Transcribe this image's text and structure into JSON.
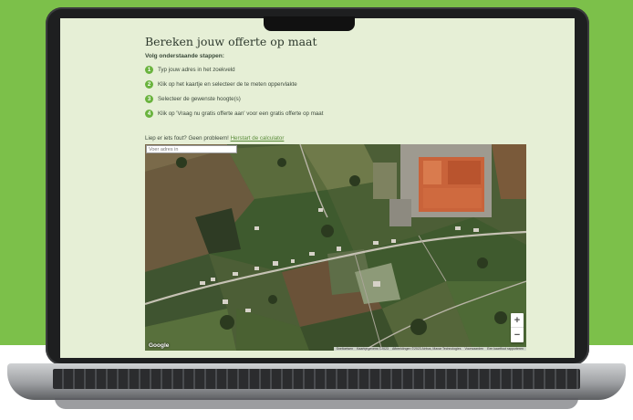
{
  "page": {
    "title": "Bereken jouw offerte op maat",
    "subtitle": "Volg onderstaande stappen:",
    "steps": [
      {
        "num": "1",
        "text": "Typ jouw adres in het zoekveld"
      },
      {
        "num": "2",
        "text": "Klik op het kaartje en selecteer de te meten oppervlakte"
      },
      {
        "num": "3",
        "text": "Selecteer de gewenste hoogte(s)"
      },
      {
        "num": "4",
        "text": "Klik op 'Vraag nu gratis offerte aan' voor een gratis offerte op maat"
      }
    ],
    "restart_prompt": "Liep er iets fout? Geen probleem!",
    "restart_link": "Herstart de calculator"
  },
  "map": {
    "search_placeholder": "Voer adres in",
    "zoom_in": "+",
    "zoom_out": "−",
    "logo": "Google",
    "attribution": [
      "Sneltoetsen",
      "Kaartgegevens ©2023",
      "Afbeeldingen ©2023 Airbus, Maxar Technologies",
      "Voorwaarden",
      "Een kaartfout rapporteren"
    ]
  },
  "colors": {
    "background_green": "#7cc04a",
    "page_background": "#e6efd6",
    "step_badge": "#6ab33e",
    "link": "#5a8c3a"
  }
}
